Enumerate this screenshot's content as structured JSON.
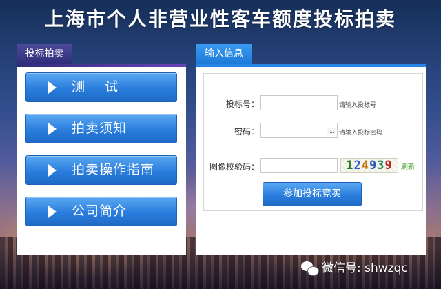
{
  "page": {
    "title": "上海市个人非营业性客车额度投标拍卖"
  },
  "left_panel": {
    "tab_label": "投标拍卖",
    "buttons": [
      {
        "label": "测    试"
      },
      {
        "label": "拍卖须知"
      },
      {
        "label": "拍卖操作指南"
      },
      {
        "label": "公司简介"
      }
    ]
  },
  "right_panel": {
    "tab_label": "输入信息",
    "form": {
      "bid_number": {
        "label": "投标号：",
        "value": "",
        "hint": "请输入投标号"
      },
      "password": {
        "label": "密码：",
        "value": "",
        "hint": "请输入投标密码"
      },
      "captcha": {
        "label": "图像校验码：",
        "value": "",
        "image_text": "124939",
        "refresh_label": "刷新"
      },
      "submit_label": "参加投标竞买"
    }
  },
  "watermark": {
    "text": "微信号: shwzqc"
  },
  "colors": {
    "button_blue": "#2a7ddc",
    "left_tab": "#3a3888",
    "right_tab": "#2786e4",
    "refresh_green": "#3a9a1a"
  }
}
